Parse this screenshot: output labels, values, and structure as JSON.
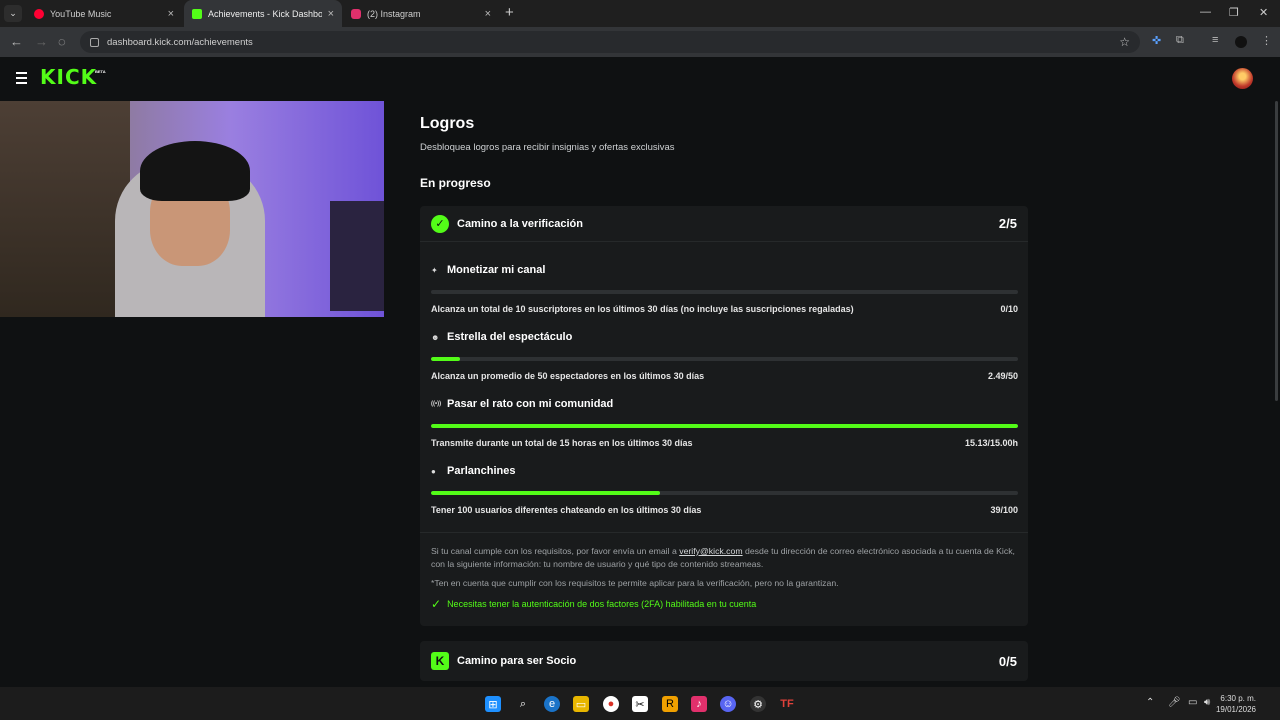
{
  "browser": {
    "tabs": [
      {
        "label": "YouTube Music",
        "color": "#ff0033"
      },
      {
        "label": "Achievements - Kick Dashboard",
        "color": "#53fc18"
      },
      {
        "label": "(2) Instagram",
        "color": "#e1306c"
      }
    ],
    "url": "dashboard.kick.com/achievements"
  },
  "kick": {
    "logo": "KICK",
    "beta": "BETA",
    "page_title": "Logros",
    "page_subtitle": "Desbloquea logros para recibir insignias y ofertas exclusivas",
    "section_title": "En progreso",
    "verification": {
      "title": "Camino a la verificación",
      "count": "2/5",
      "tasks": [
        {
          "icon": "sparkle-icon",
          "glyph": "✦",
          "title": "Monetizar mi canal",
          "description": "Alcanza un total de 10 suscriptores en los últimos 30 días (no incluye las suscripciones regaladas)",
          "progress": "0/10",
          "fraction": 0.0
        },
        {
          "icon": "users-icon",
          "glyph": "☻",
          "title": "Estrella del espectáculo",
          "description": "Alcanza un promedio de 50 espectadores en los últimos 30 días",
          "progress": "2.49/50",
          "fraction": 0.05
        },
        {
          "icon": "broadcast-icon",
          "glyph": "((•))",
          "title": "Pasar el rato con mi comunidad",
          "description": "Transmite durante un total de 15 horas en los últimos 30 días",
          "progress": "15.13/15.00h",
          "fraction": 1.0
        },
        {
          "icon": "chat-icon",
          "glyph": "●",
          "title": "Parlanchines",
          "description": "Tener 100 usuarios diferentes chateando en los últimos 30 días",
          "progress": "39/100",
          "fraction": 0.39
        }
      ],
      "info_before": "Si tu canal cumple con los requisitos, por favor envía un email a ",
      "info_email": "verify@kick.com",
      "info_after": " desde tu dirección de correo electrónico asociada a tu cuenta de Kick, con la siguiente información: tu nombre de usuario y qué tipo de contenido streameas.",
      "disclaimer": "*Ten en cuenta que cumplir con los requisitos te permite aplicar para la verificación, pero no la garantizan.",
      "twofa": "Necesitas tener la autenticación de dos factores (2FA) habilitada en tu cuenta"
    },
    "partner": {
      "title": "Camino para ser Socio",
      "count": "0/5"
    }
  },
  "taskbar": {
    "time": "6:30 p. m.",
    "date": "19/01/2026"
  },
  "colors": {
    "accent": "#53fc18",
    "background": "#0f1112",
    "card": "#191b1c"
  }
}
